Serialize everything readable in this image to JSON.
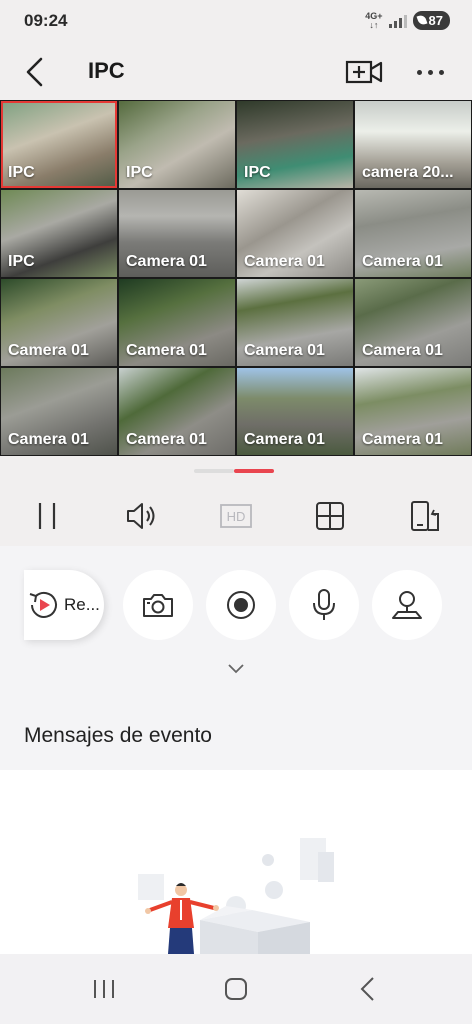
{
  "status_bar": {
    "time": "09:24",
    "network_top": "4G+",
    "network_bottom": "↓↑",
    "battery": "87"
  },
  "header": {
    "title": "IPC"
  },
  "cameras": [
    {
      "label": "IPC",
      "bg": "linear-gradient(160deg,#7da080 0%,#c9c2b0 40%,#8a7d6a 70%,#4f5a45 100%)"
    },
    {
      "label": "IPC",
      "bg": "linear-gradient(150deg,#556b3e 0%,#9aa389 35%,#c0bbb0 60%,#6c6a5e 100%)"
    },
    {
      "label": "IPC",
      "bg": "linear-gradient(170deg,#2f3a2a 0%,#6b6a5f 40%,#3f8d73 70%,#b9b4a8 100%)"
    },
    {
      "label": "camera 20...",
      "bg": "linear-gradient(180deg,#c7ccc8 0%,#ecefe9 35%,#a6a298 70%,#6b6860 100%)"
    },
    {
      "label": "IPC",
      "bg": "linear-gradient(160deg,#6f8a55 0%,#a9a9a3 40%,#3e3e3c 70%,#7a8c62 100%)"
    },
    {
      "label": "Camera 01",
      "bg": "linear-gradient(180deg,#9a9a94 0%,#b5b5b1 30%,#7b7b78 60%,#5e5e5b 100%)"
    },
    {
      "label": "Camera 01",
      "bg": "linear-gradient(150deg,#e0ddd6 0%,#9a968e 40%,#c4c2bd 65%,#8c8a85 100%)"
    },
    {
      "label": "Camera 01",
      "bg": "linear-gradient(170deg,#b8b9b2 0%,#8b8d86 35%,#a8a9a6 70%,#6e7d5c 100%)"
    },
    {
      "label": "Camera 01",
      "bg": "linear-gradient(160deg,#2d4b2a 0%,#7f8d63 35%,#a1a09a 65%,#5d5c58 100%)"
    },
    {
      "label": "Camera 01",
      "bg": "linear-gradient(160deg,#1f3b22 0%,#56703f 35%,#8c8a84 70%,#6a6963 100%)"
    },
    {
      "label": "Camera 01",
      "bg": "linear-gradient(170deg,#cfd4d4 0%,#5c7040 30%,#a7a7a4 65%,#7a7a77 100%)"
    },
    {
      "label": "Camera 01",
      "bg": "linear-gradient(160deg,#8a9a78 0%,#5a6c4a 30%,#9c9c98 65%,#7c7c79 100%)"
    },
    {
      "label": "Camera 01",
      "bg": "linear-gradient(160deg,#6c7a5c 0%,#9b9c95 40%,#73736f 70%,#4f524b 100%)"
    },
    {
      "label": "Camera 01",
      "bg": "linear-gradient(150deg,#c8d0cf 0%,#4f6a3a 35%,#8e8d87 65%,#6e6d69 100%)"
    },
    {
      "label": "Camera 01",
      "bg": "linear-gradient(180deg,#9fc3e6 0%,#7d8b6a 35%,#6f6e68 65%,#4b5a3f 100%)"
    },
    {
      "label": "Camera 01",
      "bg": "linear-gradient(170deg,#dfe4e6 0%,#7c8d63 35%,#a09f9a 65%,#707b5a 100%)"
    }
  ],
  "toolbar": {
    "hd_label": "HD"
  },
  "actions": {
    "replay_label": "Re..."
  },
  "messages": {
    "title": "Mensajes de evento"
  },
  "colors": {
    "accent": "#e9454f",
    "selected_border": "#e53935"
  }
}
